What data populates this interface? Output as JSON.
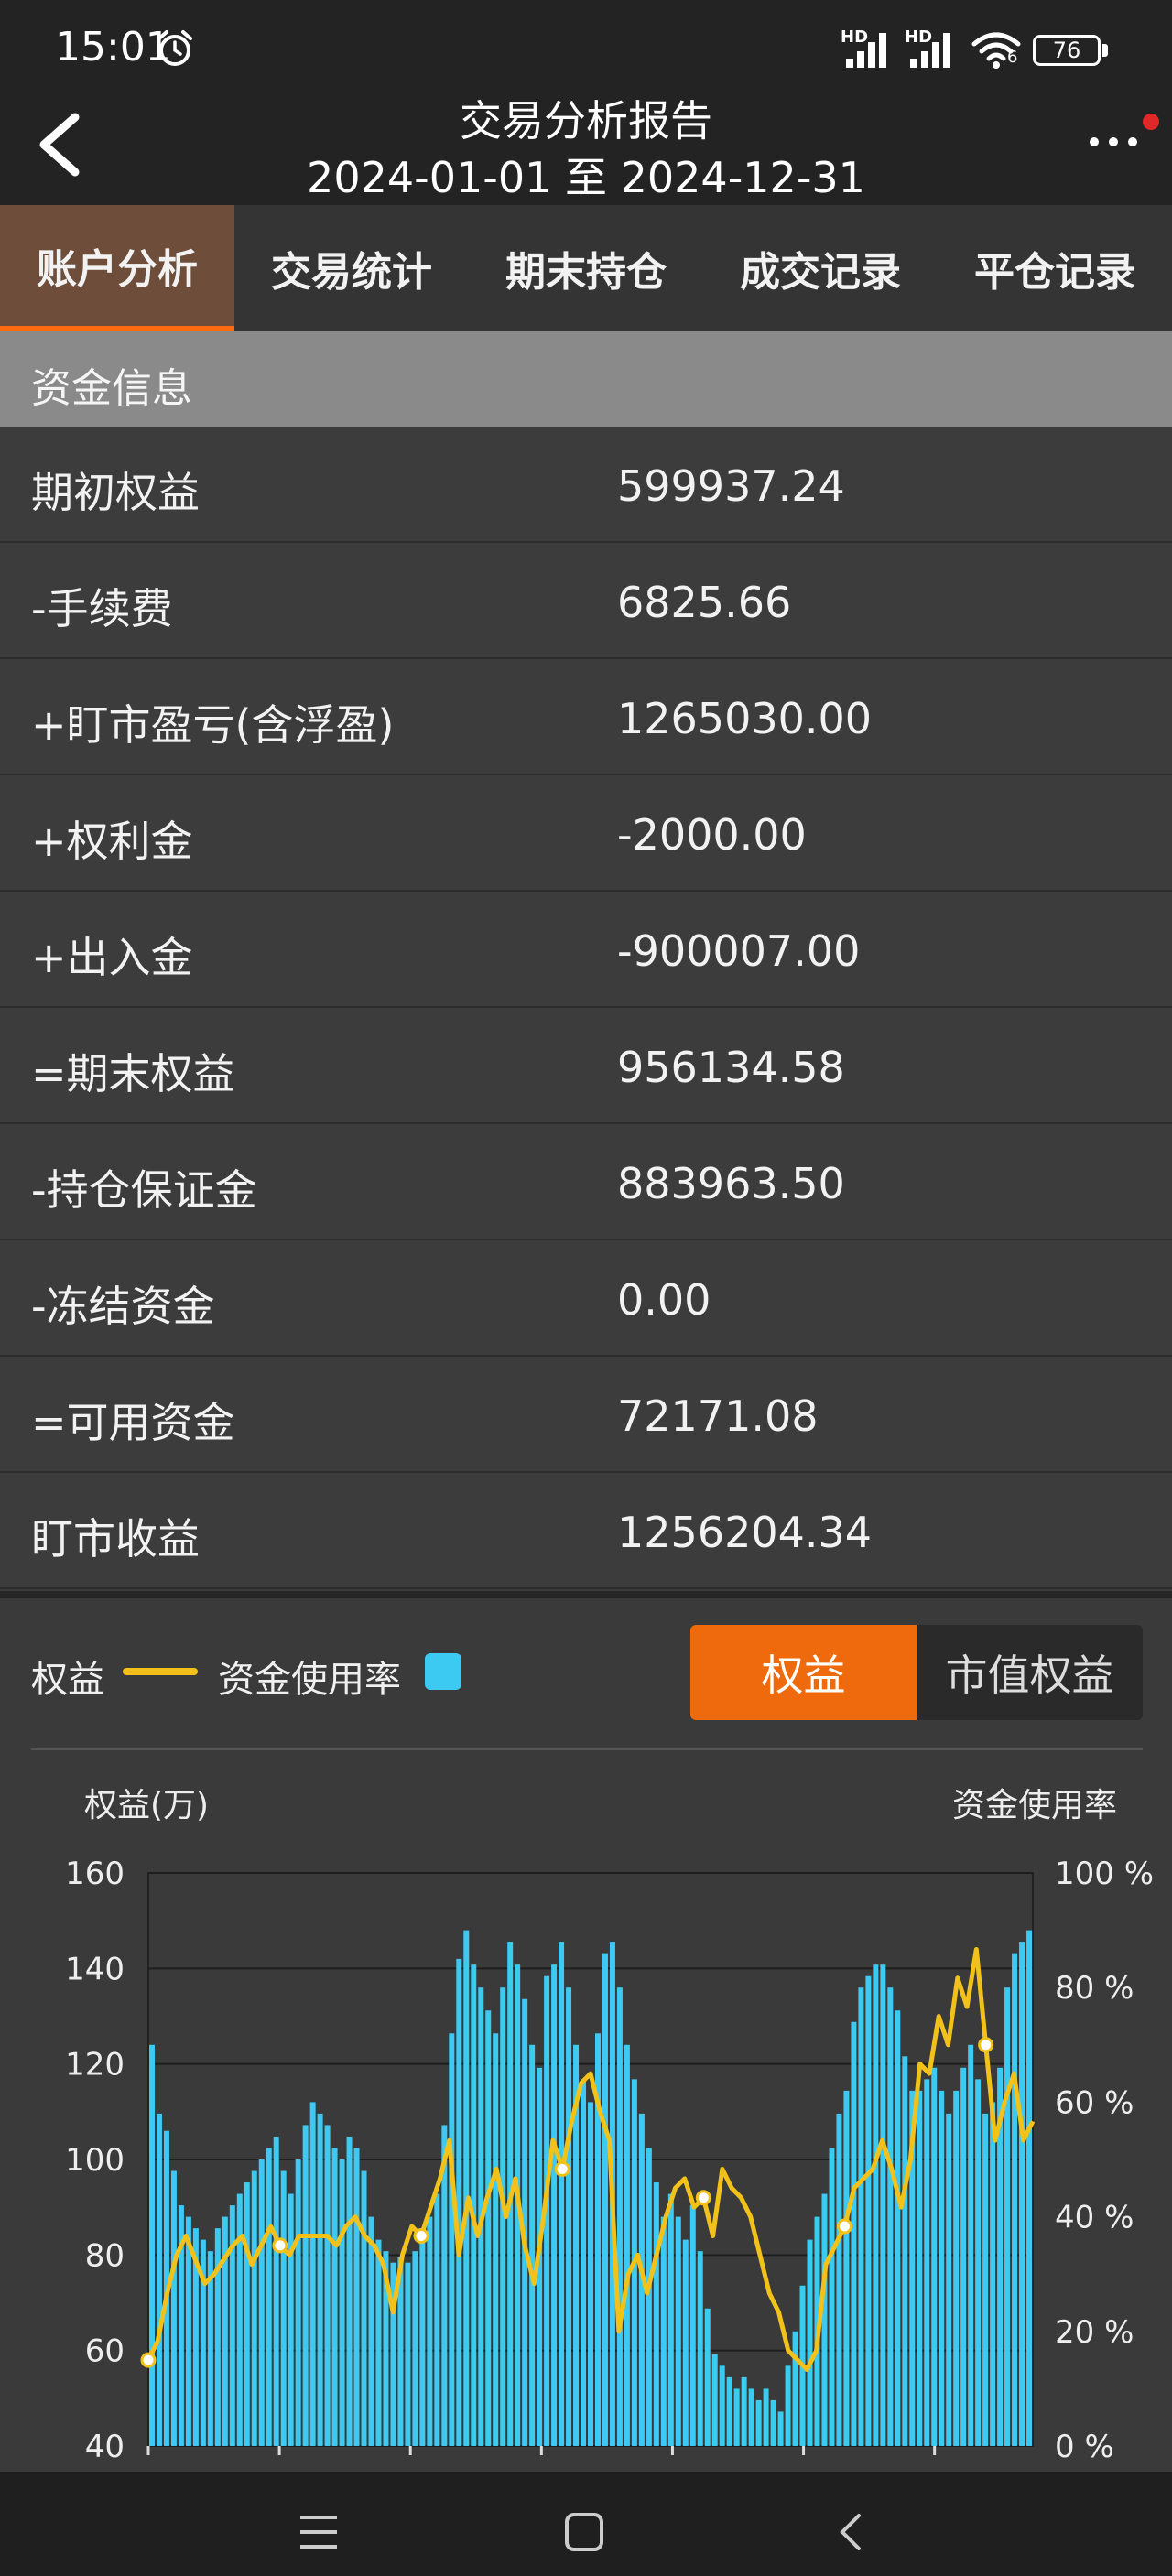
{
  "status": {
    "time": "15:01",
    "signal_tag": "HD",
    "battery": "76",
    "wifi_badge": "6"
  },
  "header": {
    "title": "交易分析报告",
    "subtitle": "2024-01-01 至 2024-12-31"
  },
  "tabs": [
    {
      "label": "账户分析"
    },
    {
      "label": "交易统计"
    },
    {
      "label": "期末持仓"
    },
    {
      "label": "成交记录"
    },
    {
      "label": "平仓记录"
    }
  ],
  "section": {
    "title": "资金信息"
  },
  "rows": [
    {
      "label": "期初权益",
      "value": "599937.24"
    },
    {
      "label": "-手续费",
      "value": "6825.66"
    },
    {
      "label": "+盯市盈亏(含浮盈)",
      "value": "1265030.00"
    },
    {
      "label": "+权利金",
      "value": "-2000.00"
    },
    {
      "label": "+出入金",
      "value": "-900007.00"
    },
    {
      "label": "=期末权益",
      "value": "956134.58"
    },
    {
      "label": "-持仓保证金",
      "value": "883963.50"
    },
    {
      "label": "-冻结资金",
      "value": "0.00"
    },
    {
      "label": "=可用资金",
      "value": "72171.08"
    },
    {
      "label": "盯市收益",
      "value": "1256204.34"
    }
  ],
  "legend": {
    "equity": "权益",
    "usage": "资金使用率"
  },
  "toggle": {
    "left": "权益",
    "right": "市值权益"
  },
  "colors": {
    "accent": "#ee6a0c",
    "equity_line": "#f2c21a",
    "usage_bar": "#3cc9f2"
  },
  "chart_data": {
    "type": "bar",
    "ylabel_left": "权益(万)",
    "ylabel_right": "资金使用率",
    "yticks_left": [
      "160",
      "140",
      "120",
      "100",
      "80",
      "60",
      "40"
    ],
    "yticks_right": [
      "100 %",
      "80 %",
      "60 %",
      "40 %",
      "20 %",
      "0 %"
    ],
    "ylim_left": [
      40,
      160
    ],
    "ylim_right": [
      0,
      100
    ],
    "usage_pct": [
      70,
      58,
      55,
      48,
      42,
      40,
      38,
      36,
      34,
      38,
      40,
      42,
      44,
      46,
      48,
      50,
      52,
      54,
      48,
      44,
      50,
      56,
      60,
      58,
      56,
      52,
      50,
      54,
      52,
      48,
      40,
      36,
      34,
      32,
      33,
      32,
      34,
      36,
      40,
      44,
      56,
      72,
      85,
      90,
      84,
      80,
      76,
      72,
      80,
      88,
      84,
      78,
      70,
      66,
      82,
      84,
      88,
      80,
      70,
      64,
      60,
      72,
      86,
      88,
      80,
      70,
      64,
      58,
      52,
      46,
      40,
      44,
      40,
      36,
      42,
      34,
      24,
      16,
      14,
      12,
      10,
      12,
      10,
      8,
      10,
      8,
      6,
      14,
      20,
      28,
      36,
      40,
      44,
      52,
      58,
      62,
      74,
      80,
      82,
      84,
      84,
      80,
      76,
      68,
      62,
      62,
      64,
      66,
      62,
      58,
      62,
      66,
      70,
      64,
      58,
      60,
      66,
      80,
      86,
      88,
      90
    ],
    "equity": [
      58,
      62,
      72,
      80,
      84,
      79,
      74,
      76,
      79,
      82,
      84,
      78,
      82,
      86,
      82,
      80,
      84,
      84,
      84,
      84,
      82,
      86,
      88,
      84,
      82,
      78,
      68,
      80,
      86,
      84,
      90,
      96,
      104,
      80,
      92,
      84,
      92,
      98,
      88,
      96,
      82,
      74,
      88,
      104,
      98,
      108,
      116,
      118,
      110,
      104,
      64,
      76,
      80,
      72,
      80,
      88,
      94,
      96,
      90,
      92,
      84,
      98,
      94,
      92,
      88,
      80,
      72,
      68,
      60,
      58,
      56,
      60,
      78,
      82,
      86,
      94,
      96,
      98,
      104,
      98,
      90,
      100,
      120,
      118,
      130,
      124,
      138,
      132,
      144,
      124,
      104,
      112,
      118,
      104,
      108
    ]
  }
}
